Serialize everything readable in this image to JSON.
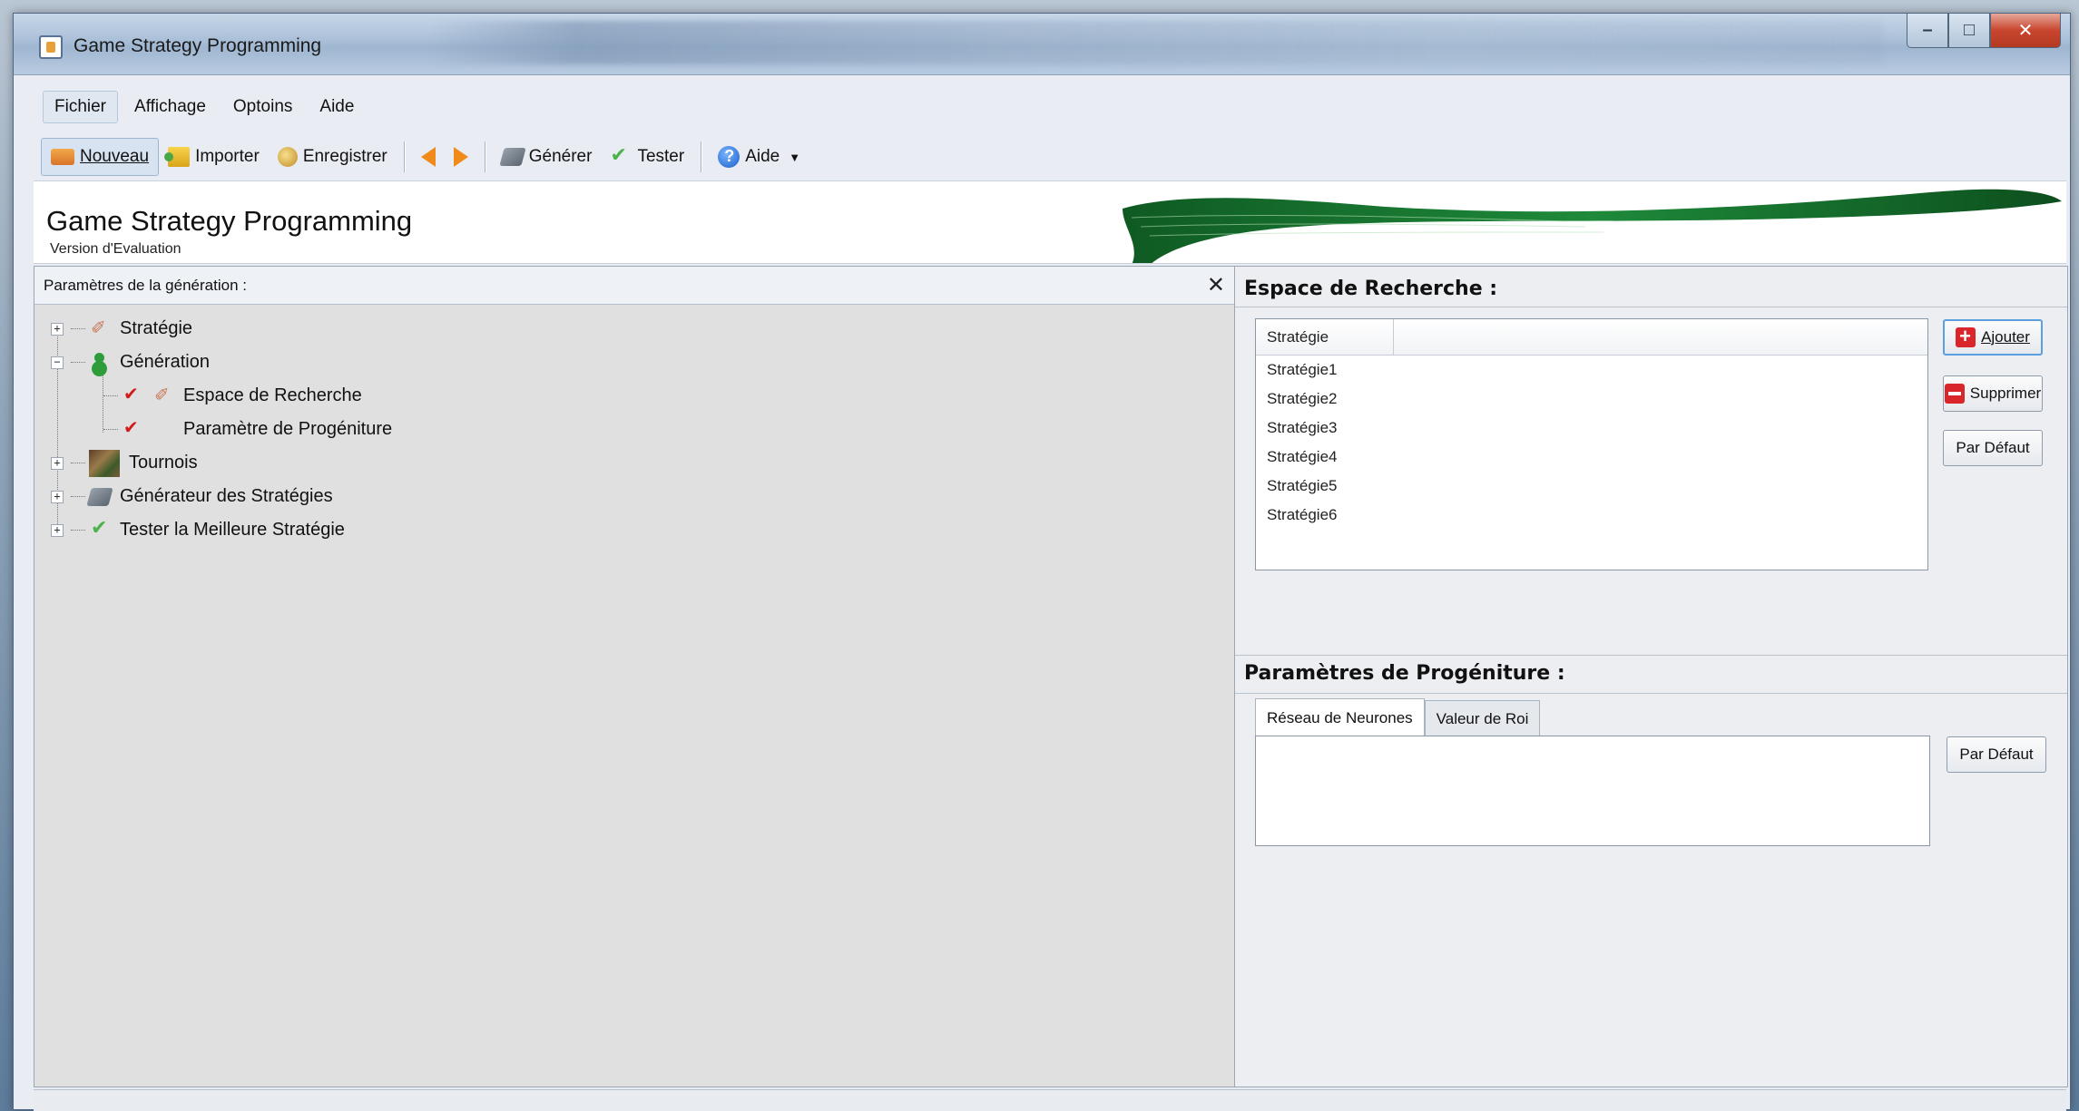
{
  "window": {
    "title": "Game Strategy Programming",
    "controls": {
      "minimize": "–",
      "maximize": "□",
      "close": "✕"
    }
  },
  "menu": {
    "items": [
      "Fichier",
      "Affichage",
      "Optoins",
      "Aide"
    ]
  },
  "toolbar": {
    "new_label": "Nouveau",
    "import_label": "Importer",
    "save_label": "Enregistrer",
    "generate_label": "Générer",
    "test_label": "Tester",
    "help_label": "Aide"
  },
  "banner": {
    "title": "Game Strategy Programming",
    "subtitle": "Version d'Evaluation"
  },
  "left_panel": {
    "header": "Paramètres de la génération :",
    "close_symbol": "✕",
    "tree": [
      {
        "label": "Stratégie",
        "expander": "+"
      },
      {
        "label": "Génération",
        "expander": "−"
      },
      {
        "label": "Espace de Recherche"
      },
      {
        "label": "Paramètre de Progéniture"
      },
      {
        "label": "Tournois",
        "expander": "+"
      },
      {
        "label": "Générateur des Stratégies",
        "expander": "+"
      },
      {
        "label": "Tester la Meilleure Stratégie",
        "expander": "+"
      }
    ]
  },
  "search_space": {
    "title": "Espace de Recherche :",
    "column_header": "Stratégie",
    "rows": [
      "Stratégie1",
      "Stratégie2",
      "Stratégie3",
      "Stratégie4",
      "Stratégie5",
      "Stratégie6"
    ],
    "add_label": "Ajouter",
    "delete_label": "Supprimer",
    "default_label": "Par Défaut"
  },
  "offspring": {
    "title": "Paramètres de Progéniture :",
    "tabs": [
      "Réseau de Neurones",
      "Valeur de Roi"
    ],
    "default_label": "Par Défaut"
  },
  "colors": {
    "accent_blue": "#5aa0e0",
    "delete_red": "#d8262a",
    "check_green": "#4cb34a",
    "check_red": "#d21b1b"
  }
}
